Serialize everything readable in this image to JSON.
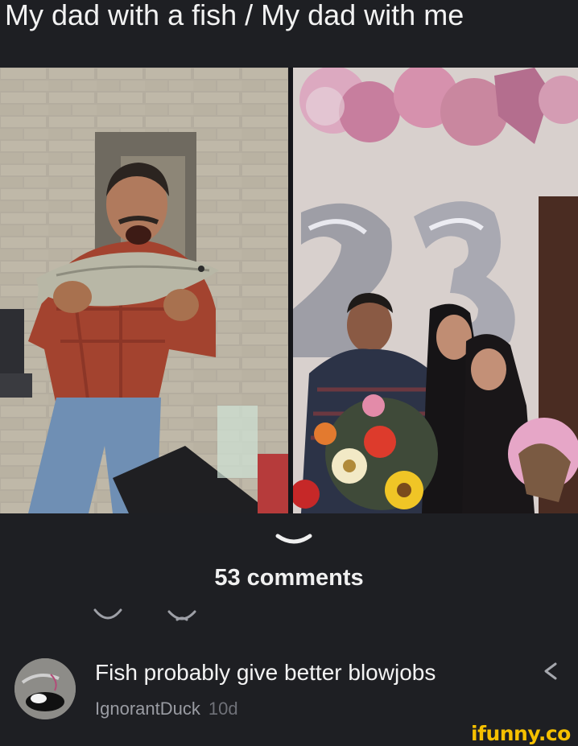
{
  "post": {
    "caption": "My dad with a fish / My dad with me"
  },
  "comments": {
    "count_label": "53 comments",
    "items": [
      {
        "text": "Fish probably give better blowjobs",
        "username": "IgnorantDuck",
        "time": "10d"
      }
    ]
  },
  "icons": {
    "expand": "chevron-down-icon",
    "like": "smile-icon",
    "dislike": "frown-icon",
    "share": "share-icon"
  },
  "watermark": "ifunny.co",
  "colors": {
    "background": "#1e1f23",
    "watermark": "#f5c000",
    "username": "#9a9ca3"
  }
}
